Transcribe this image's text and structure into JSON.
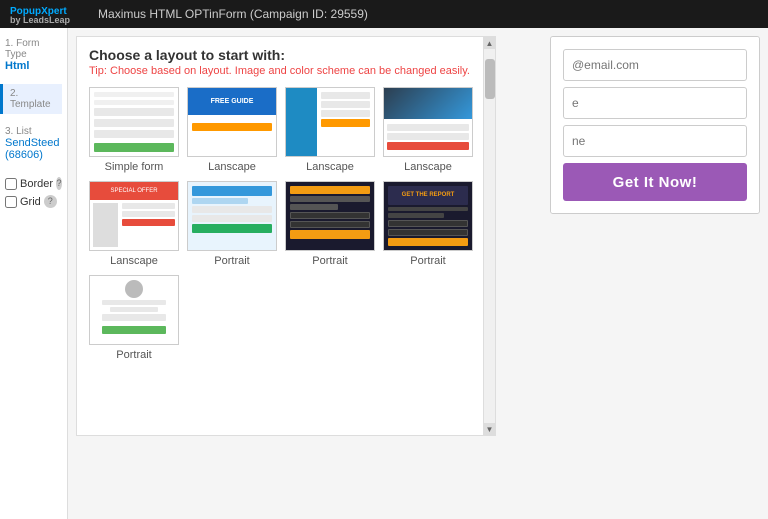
{
  "topbar": {
    "brand": "PopupXpert",
    "brand_sub": "by LeadsLeap",
    "title": "Maximus HTML OPTinForm (Campaign ID: 29559)"
  },
  "sidebar": {
    "step1_num": "1. Form Type",
    "step1_label": "Html",
    "step2_num": "2. Template",
    "step3_num": "3. List",
    "step3_label": "SendSteed",
    "step3_sub": "(68606)",
    "border_label": "Border",
    "grid_label": "Grid"
  },
  "layout_panel": {
    "heading": "Choose a layout to start with:",
    "tip_prefix": "Tip: ",
    "tip_highlight": "Choose based on layout.",
    "tip_suffix": " Image and color scheme can be changed easily."
  },
  "templates": [
    {
      "id": "simple-form",
      "label": "Simple form"
    },
    {
      "id": "landscape-1",
      "label": "Lanscape"
    },
    {
      "id": "landscape-2",
      "label": "Lanscape"
    },
    {
      "id": "landscape-3",
      "label": "Lanscape"
    },
    {
      "id": "landscape-4",
      "label": "Lanscape"
    },
    {
      "id": "portrait-1",
      "label": "Portrait"
    },
    {
      "id": "portrait-2",
      "label": "Portrait"
    },
    {
      "id": "portrait-3",
      "label": "Portrait"
    },
    {
      "id": "portrait-4",
      "label": "Portrait"
    }
  ],
  "preview": {
    "email_placeholder": "@email.com",
    "name_placeholder": "e",
    "phone_placeholder": "ne",
    "button_label": "Get It Now!"
  },
  "scrollbar": {
    "up_arrow": "▲",
    "down_arrow": "▼"
  }
}
